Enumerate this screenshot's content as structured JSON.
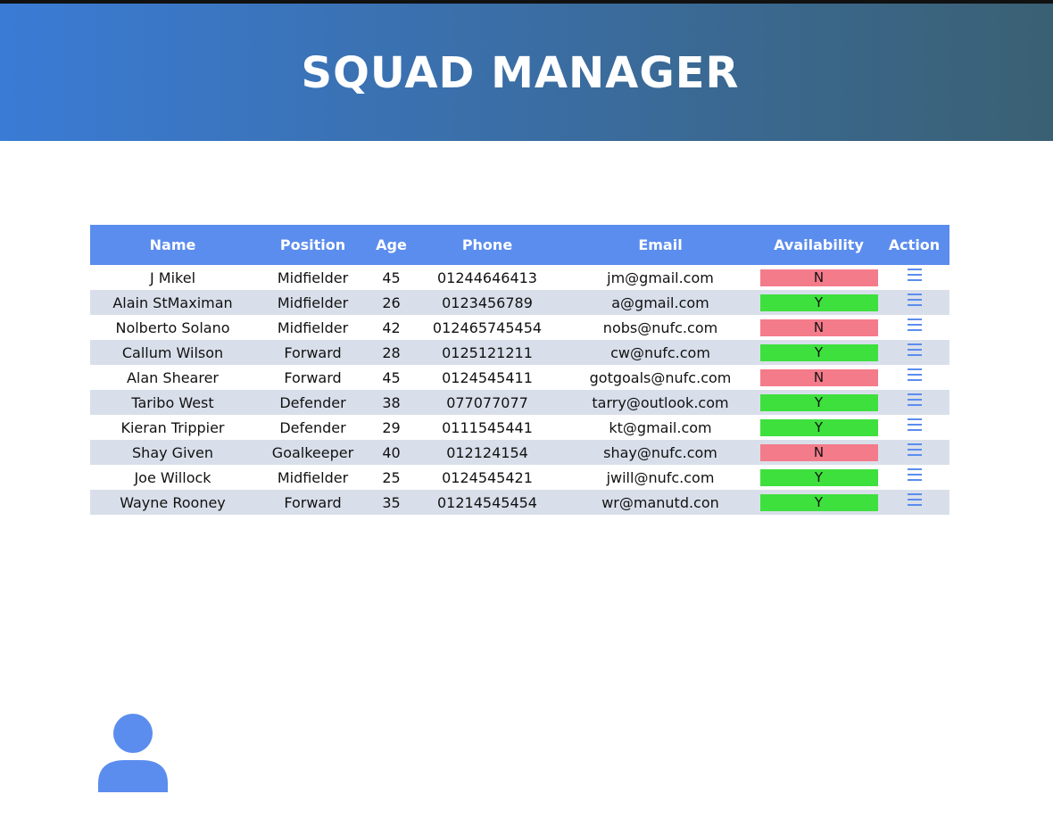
{
  "app": {
    "title": "SQUAD MANAGER"
  },
  "colors": {
    "header_gradient_start": "#3a7bd5",
    "header_gradient_end": "#3a6073",
    "table_header": "#5b8dee",
    "row_stripe": "#d9dfea",
    "available_yes": "#3ee03e",
    "available_no": "#f47b8a",
    "icon_accent": "#5b8dee"
  },
  "table": {
    "headers": {
      "name": "Name",
      "position": "Position",
      "age": "Age",
      "phone": "Phone",
      "email": "Email",
      "availability": "Availability",
      "action": "Action"
    },
    "rows": [
      {
        "name": "J Mikel",
        "position": "Midfielder",
        "age": "45",
        "phone": "01244646413",
        "email": "jm@gmail.com",
        "availability": "N"
      },
      {
        "name": "Alain StMaximan",
        "position": "Midfielder",
        "age": "26",
        "phone": "0123456789",
        "email": "a@gmail.com",
        "availability": "Y"
      },
      {
        "name": "Nolberto Solano",
        "position": "Midfielder",
        "age": "42",
        "phone": "012465745454",
        "email": "nobs@nufc.com",
        "availability": "N"
      },
      {
        "name": "Callum Wilson",
        "position": "Forward",
        "age": "28",
        "phone": "0125121211",
        "email": "cw@nufc.com",
        "availability": "Y"
      },
      {
        "name": "Alan Shearer",
        "position": "Forward",
        "age": "45",
        "phone": "0124545411",
        "email": "gotgoals@nufc.com",
        "availability": "N"
      },
      {
        "name": "Taribo West",
        "position": "Defender",
        "age": "38",
        "phone": "077077077",
        "email": "tarry@outlook.com",
        "availability": "Y"
      },
      {
        "name": "Kieran Trippier",
        "position": "Defender",
        "age": "29",
        "phone": "0111545441",
        "email": "kt@gmail.com",
        "availability": "Y"
      },
      {
        "name": "Shay Given",
        "position": "Goalkeeper",
        "age": "40",
        "phone": "012124154",
        "email": "shay@nufc.com",
        "availability": "N"
      },
      {
        "name": "Joe Willock",
        "position": "Midfielder",
        "age": "25",
        "phone": "0124545421",
        "email": "jwill@nufc.com",
        "availability": "Y"
      },
      {
        "name": "Wayne Rooney",
        "position": "Forward",
        "age": "35",
        "phone": "01214545454",
        "email": "wr@manutd.con",
        "availability": "Y"
      }
    ],
    "action_icon": "menu-icon"
  },
  "footer": {
    "avatar_icon": "user-icon"
  }
}
